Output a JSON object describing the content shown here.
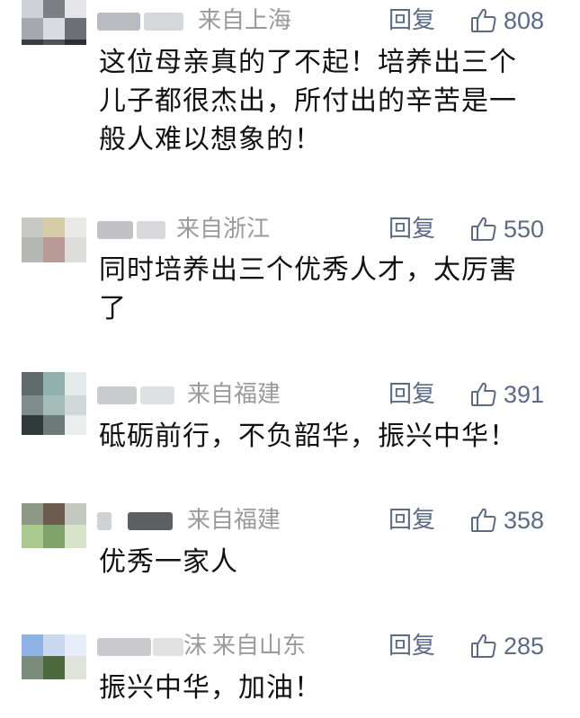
{
  "comments": [
    {
      "location": "来自上海",
      "reply_label": "回复",
      "likes": "808",
      "lines": [
        "这位母亲真的了不起！培养出三个",
        "儿子都很杰出，所付出的辛苦是一",
        "般人难以想象的！"
      ]
    },
    {
      "location": "来自浙江",
      "reply_label": "回复",
      "likes": "550",
      "lines": [
        "同时培养出三个优秀人才，太厉害",
        "了"
      ]
    },
    {
      "location": "来自福建",
      "reply_label": "回复",
      "likes": "391",
      "lines": [
        "砥砺前行，不负韶华，振兴中华！"
      ]
    },
    {
      "location": "来自福建",
      "reply_label": "回复",
      "likes": "358",
      "lines": [
        "优秀一家人"
      ]
    },
    {
      "username_visible": "沫",
      "location": "来自山东",
      "reply_label": "回复",
      "likes": "285",
      "lines": [
        "振兴中华，加油！"
      ]
    }
  ],
  "icons": {
    "like": "thumbs-up-icon"
  },
  "colors": {
    "accent": "#5a6a87",
    "meta": "#9a9a9a",
    "text": "#111111"
  }
}
